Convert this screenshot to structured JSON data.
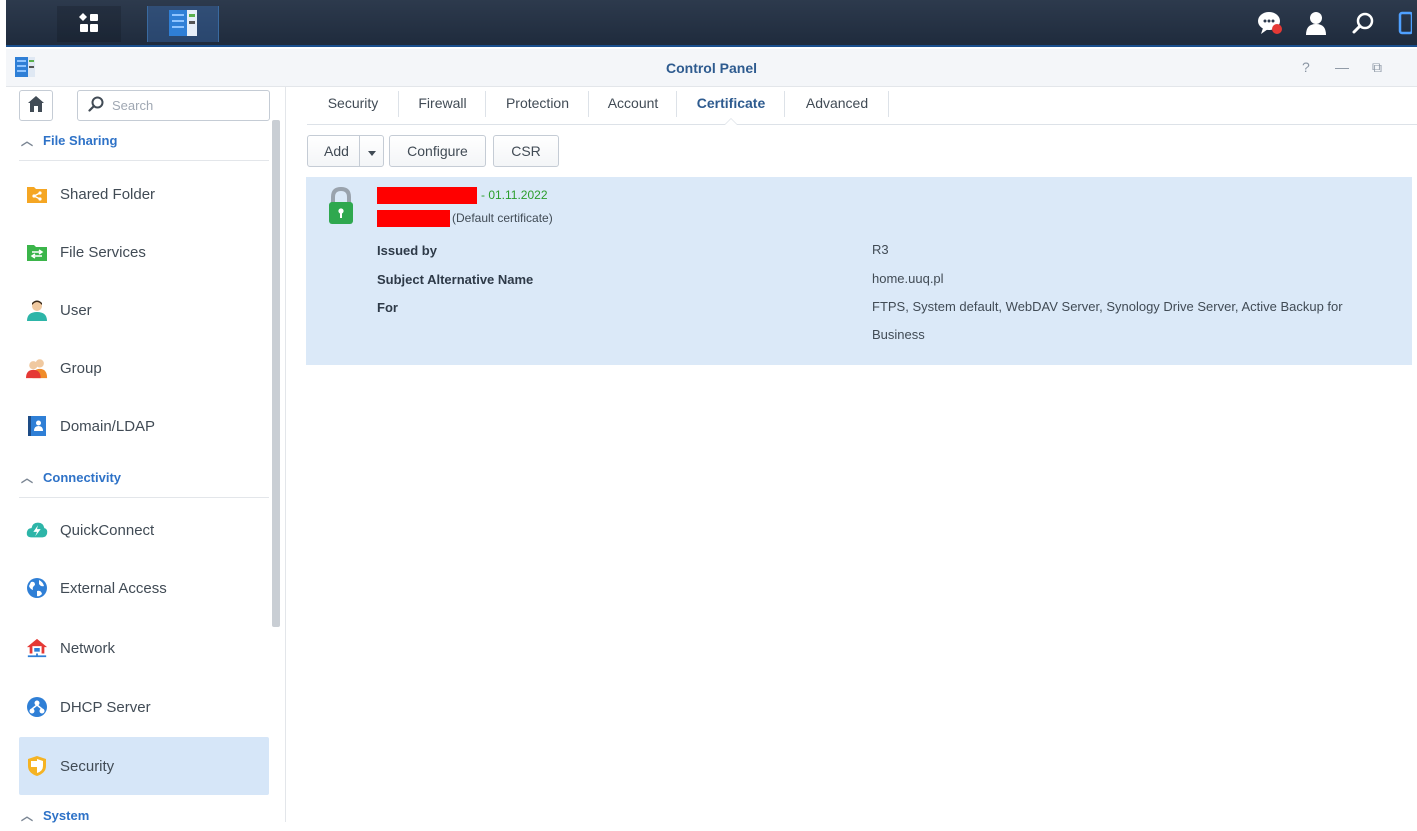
{
  "window": {
    "title": "Control Panel"
  },
  "taskbar": {
    "left_icons": [
      "apps-grid-icon",
      "control-panel-icon"
    ],
    "right_icons": [
      "notification-chat-icon",
      "user-icon",
      "search-icon",
      "widget-icon"
    ]
  },
  "window_controls": {
    "help": "?",
    "minimize": "—",
    "restore": "⧉"
  },
  "sidebar": {
    "search_placeholder": "Search",
    "sections": {
      "file_sharing": "File Sharing",
      "connectivity": "Connectivity",
      "system": "System"
    },
    "items": [
      {
        "label": "Shared Folder",
        "icon": "shared-folder-icon"
      },
      {
        "label": "File Services",
        "icon": "file-services-icon"
      },
      {
        "label": "User",
        "icon": "user-icon"
      },
      {
        "label": "Group",
        "icon": "group-icon"
      },
      {
        "label": "Domain/LDAP",
        "icon": "domain-ldap-icon"
      },
      {
        "label": "QuickConnect",
        "icon": "quickconnect-icon"
      },
      {
        "label": "External Access",
        "icon": "external-access-icon"
      },
      {
        "label": "Network",
        "icon": "network-icon"
      },
      {
        "label": "DHCP Server",
        "icon": "dhcp-server-icon"
      },
      {
        "label": "Security",
        "icon": "security-shield-icon",
        "active": true
      }
    ]
  },
  "tabs": [
    "Security",
    "Firewall",
    "Protection",
    "Account",
    "Certificate",
    "Advanced"
  ],
  "active_tab": "Certificate",
  "toolbar": {
    "add": "Add",
    "configure": "Configure",
    "csr": "CSR"
  },
  "certificate": {
    "date_suffix": "- 01.11.2022",
    "default_note": "(Default certificate)",
    "rows": [
      {
        "label": "Issued by",
        "value": "R3"
      },
      {
        "label": "Subject Alternative Name",
        "value": "home.uuq.pl"
      },
      {
        "label": "For",
        "value": "FTPS, System default, WebDAV Server, Synology Drive Server, Active Backup for Business"
      }
    ]
  },
  "colors": {
    "accent": "#2e72c7",
    "title": "#2e5b8f",
    "selected_bg": "#dbe9f8",
    "lock_green": "#2fa84f",
    "date_green": "#2c9e2c",
    "redaction": "#ff0000"
  }
}
